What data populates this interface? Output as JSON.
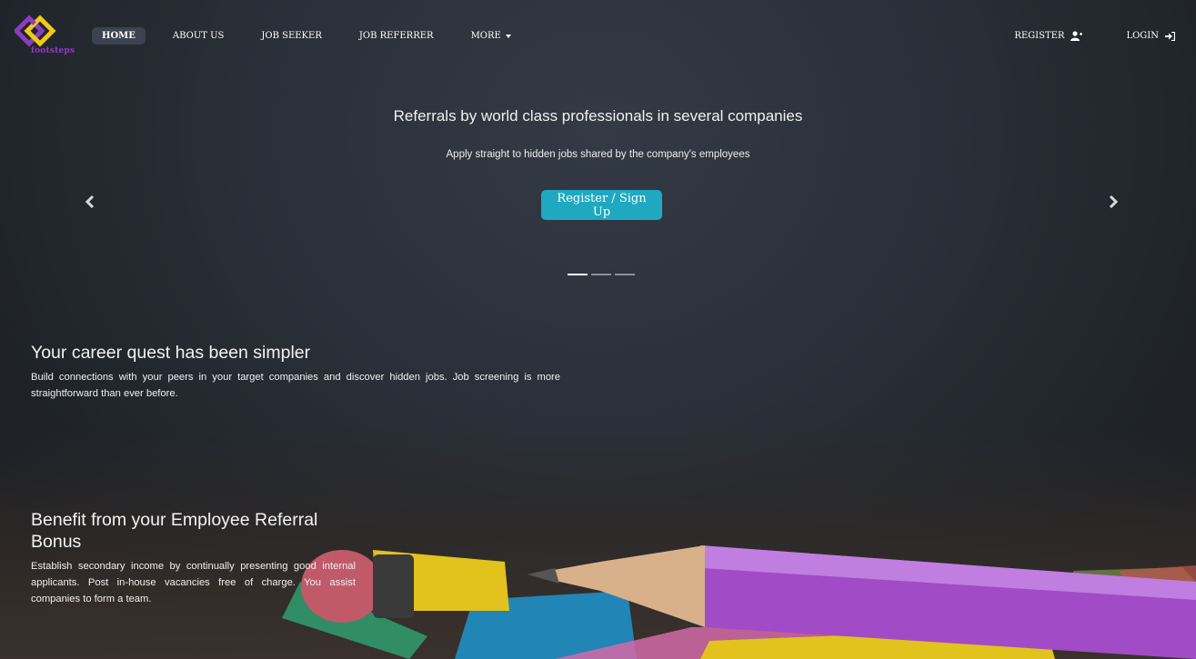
{
  "brand": {
    "logo_text": "footsteps"
  },
  "nav": {
    "items": [
      {
        "label": "HOME",
        "active": true
      },
      {
        "label": "ABOUT US",
        "active": false
      },
      {
        "label": "JOB SEEKER",
        "active": false
      },
      {
        "label": "JOB REFERRER",
        "active": false
      },
      {
        "label": "MORE",
        "active": false,
        "dropdown": true
      }
    ],
    "register_label": "REGISTER",
    "register_icon": "user-plus-icon",
    "login_label": "LOGIN",
    "login_icon": "sign-in-icon"
  },
  "carousel": {
    "title": "Referrals by world class professionals in several companies",
    "subtitle": "Apply straight to hidden jobs shared by the company's employees",
    "button_label": "Register / Sign Up",
    "slide_count": 3,
    "active_slide": 1,
    "prev_icon": "chevron-left-icon",
    "next_icon": "chevron-right-icon"
  },
  "features": [
    {
      "title": "Your career quest has been simpler",
      "text": "Build connections with your peers in your target companies and discover hidden jobs. Job screening is more straightforward than ever before."
    },
    {
      "title": "Benefit from your Employee Referral Bonus",
      "text": "Establish secondary income by continually presenting good internal applicants. Post in-house vacancies free of charge. You assist companies to form a team."
    }
  ],
  "colors": {
    "accent": "#1ea9c0",
    "logo_purple": "#8d3cc2",
    "logo_yellow": "#f2c81a",
    "nav_active_bg": "#3b4350"
  }
}
